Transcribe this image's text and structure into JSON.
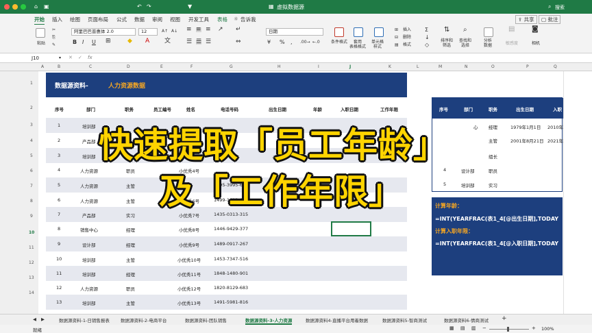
{
  "title_bar": {
    "filename": "虚拟数据源",
    "search": "搜索"
  },
  "ribbon_tabs": [
    "开始",
    "插入",
    "绘图",
    "页面布局",
    "公式",
    "数据",
    "审阅",
    "视图",
    "开发工具",
    "表格",
    "告诉我"
  ],
  "share": "共享",
  "comment": "批注",
  "ribbon": {
    "paste": "粘贴",
    "font_name": "阿里巴巴普惠体 2.0",
    "font_size": "12",
    "number_format": "日期",
    "cond_format": "条件格式",
    "table_format": "套用\n表格格式",
    "cell_style": "单元格\n样式",
    "insert": "插入",
    "delete": "删除",
    "format": "格式",
    "sort_filter": "排序和\n筛选",
    "find_select": "查找和\n选择",
    "analyze": "分析\n数据",
    "sensitivity": "敏感度",
    "camera": "相机",
    "bold": "B",
    "italic": "I",
    "underline": "U"
  },
  "formula_bar": {
    "name_box": "J10",
    "fx": "fx"
  },
  "columns": [
    "A",
    "B",
    "C",
    "D",
    "E",
    "F",
    "G",
    "H",
    "I",
    "J",
    "K",
    "L",
    "M",
    "N",
    "O",
    "P",
    "Q"
  ],
  "rows": [
    "1",
    "2",
    "3",
    "4",
    "5",
    "6",
    "7",
    "8",
    "9",
    "10",
    "11",
    "12",
    "13",
    "14"
  ],
  "sheet": {
    "title_white": "数据源资料-",
    "title_orange": "人力资源数据",
    "headers": [
      "序号",
      "部门",
      "职务",
      "员工编号",
      "姓名",
      "电话号码",
      "出生日期",
      "年龄",
      "入职日期",
      "工作年限"
    ],
    "rows": [
      {
        "no": "1",
        "dept": "培训部",
        "job": "",
        "emp": "",
        "name": "",
        "phone": ""
      },
      {
        "no": "2",
        "dept": "产品部",
        "job": "",
        "emp": "",
        "name": "",
        "phone": ""
      },
      {
        "no": "3",
        "dept": "培训部",
        "job": "",
        "emp": "",
        "name": "",
        "phone": ""
      },
      {
        "no": "4",
        "dept": "人力资源",
        "job": "职员",
        "emp": "",
        "name": "小优秀4号",
        "phone": ""
      },
      {
        "no": "5",
        "dept": "人力资源",
        "job": "主管",
        "emp": "",
        "name": "",
        "phone": "1495-3995-656"
      },
      {
        "no": "6",
        "dept": "人力资源",
        "job": "主管",
        "emp": "",
        "name": "小优秀6号",
        "phone": "1499-1623-690"
      },
      {
        "no": "7",
        "dept": "产品部",
        "job": "实习",
        "emp": "",
        "name": "小优秀7号",
        "phone": "1435-0313-315"
      },
      {
        "no": "8",
        "dept": "销售中心",
        "job": "经理",
        "emp": "",
        "name": "小优秀8号",
        "phone": "1446-9429-377"
      },
      {
        "no": "9",
        "dept": "设计部",
        "job": "经理",
        "emp": "",
        "name": "小优秀9号",
        "phone": "1489-0917-267"
      },
      {
        "no": "10",
        "dept": "培训部",
        "job": "主管",
        "emp": "",
        "name": "小优秀10号",
        "phone": "1453-7347-516"
      },
      {
        "no": "11",
        "dept": "培训部",
        "job": "经理",
        "emp": "",
        "name": "小优秀11号",
        "phone": "1848-1480-901"
      },
      {
        "no": "12",
        "dept": "人力资源",
        "job": "职员",
        "emp": "",
        "name": "小优秀12号",
        "phone": "1820-8129-683"
      },
      {
        "no": "13",
        "dept": "培训部",
        "job": "主管",
        "emp": "",
        "name": "小优秀13号",
        "phone": "1491-5981-816"
      }
    ]
  },
  "right_table": {
    "headers": [
      "序号",
      "部门",
      "职务",
      "出生日期",
      "入职"
    ],
    "rows": [
      {
        "no": "",
        "dept": "心",
        "job": "经理",
        "birth": "1979年1月1日",
        "hire": "2010年"
      },
      {
        "no": "",
        "dept": "",
        "job": "主管",
        "birth": "2001年8月21日",
        "hire": "2021年"
      },
      {
        "no": "",
        "dept": "",
        "job": "组长",
        "birth": "",
        "hire": ""
      },
      {
        "no": "4",
        "dept": "设计部",
        "job": "职员",
        "birth": "",
        "hire": ""
      },
      {
        "no": "5",
        "dept": "培训部",
        "job": "实习",
        "birth": "",
        "hire": ""
      }
    ]
  },
  "formula_box": {
    "age_label": "计算年龄：",
    "age_formula": "=INT(YEARFRAC(表1_4[@出生日期],TODAY",
    "tenure_label": "计算入职年限：",
    "tenure_formula": "=INT(YEARFRAC(表1_4[@入职日期],TODAY"
  },
  "overlay": {
    "line1": "快速提取「员工年龄」",
    "line2": "及「工作年限」"
  },
  "sheet_tabs": [
    "数据源资料-1-日销售报表",
    "数据源资料-2-电商平台",
    "数据源资料-团队销售",
    "数据源资料-3-人力资源",
    "数据源资料4-直播平台用着数据",
    "数据源资料5-智商测试",
    "数据源资料6-情商测试"
  ],
  "active_sheet_index": 3,
  "status": {
    "ready": "就绪",
    "zoom": "100%"
  }
}
